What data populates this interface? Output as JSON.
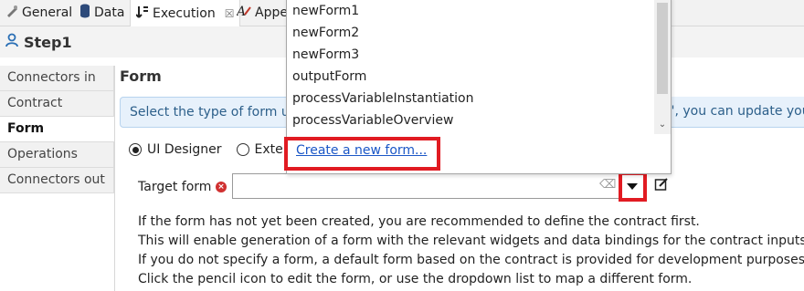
{
  "tabs": [
    {
      "label": "General",
      "icon": "properties-icon"
    },
    {
      "label": "Data",
      "icon": "database-icon"
    },
    {
      "label": "Execution",
      "icon": "execution-icon",
      "close": "☒"
    },
    {
      "label": "Appe",
      "icon": "appearance-icon"
    }
  ],
  "step": {
    "title": "Step1"
  },
  "nav": {
    "items": [
      "Connectors in",
      "Contract",
      "Form",
      "Operations",
      "Connectors out"
    ],
    "active": "Form"
  },
  "form": {
    "section_title": "Form",
    "info_text": "Select the type of form us",
    "info_tail": "\", you can update your",
    "radio_ui": "UI Designer",
    "radio_external": "Externa",
    "target_label": "Target form",
    "target_value": "",
    "help_lines": [
      "If the form has not yet been created, you are recommended to define the contract first.",
      "This will enable generation of a form with the relevant widgets and data bindings for the contract inputs.",
      "If you do not specify a form, a default form based on the contract is provided for development purposes.",
      "Click the pencil icon to edit the form, or use the dropdown list to map a different form."
    ]
  },
  "dropdown": {
    "items": [
      "newForm1",
      "newForm2",
      "newForm3",
      "outputForm",
      "processVariableInstantiation",
      "processVariableOverview"
    ],
    "create_link": "Create a new form..."
  },
  "colors": {
    "highlight": "#e11b22",
    "info_bg": "#e7f1fb",
    "link": "#1a56c6"
  }
}
